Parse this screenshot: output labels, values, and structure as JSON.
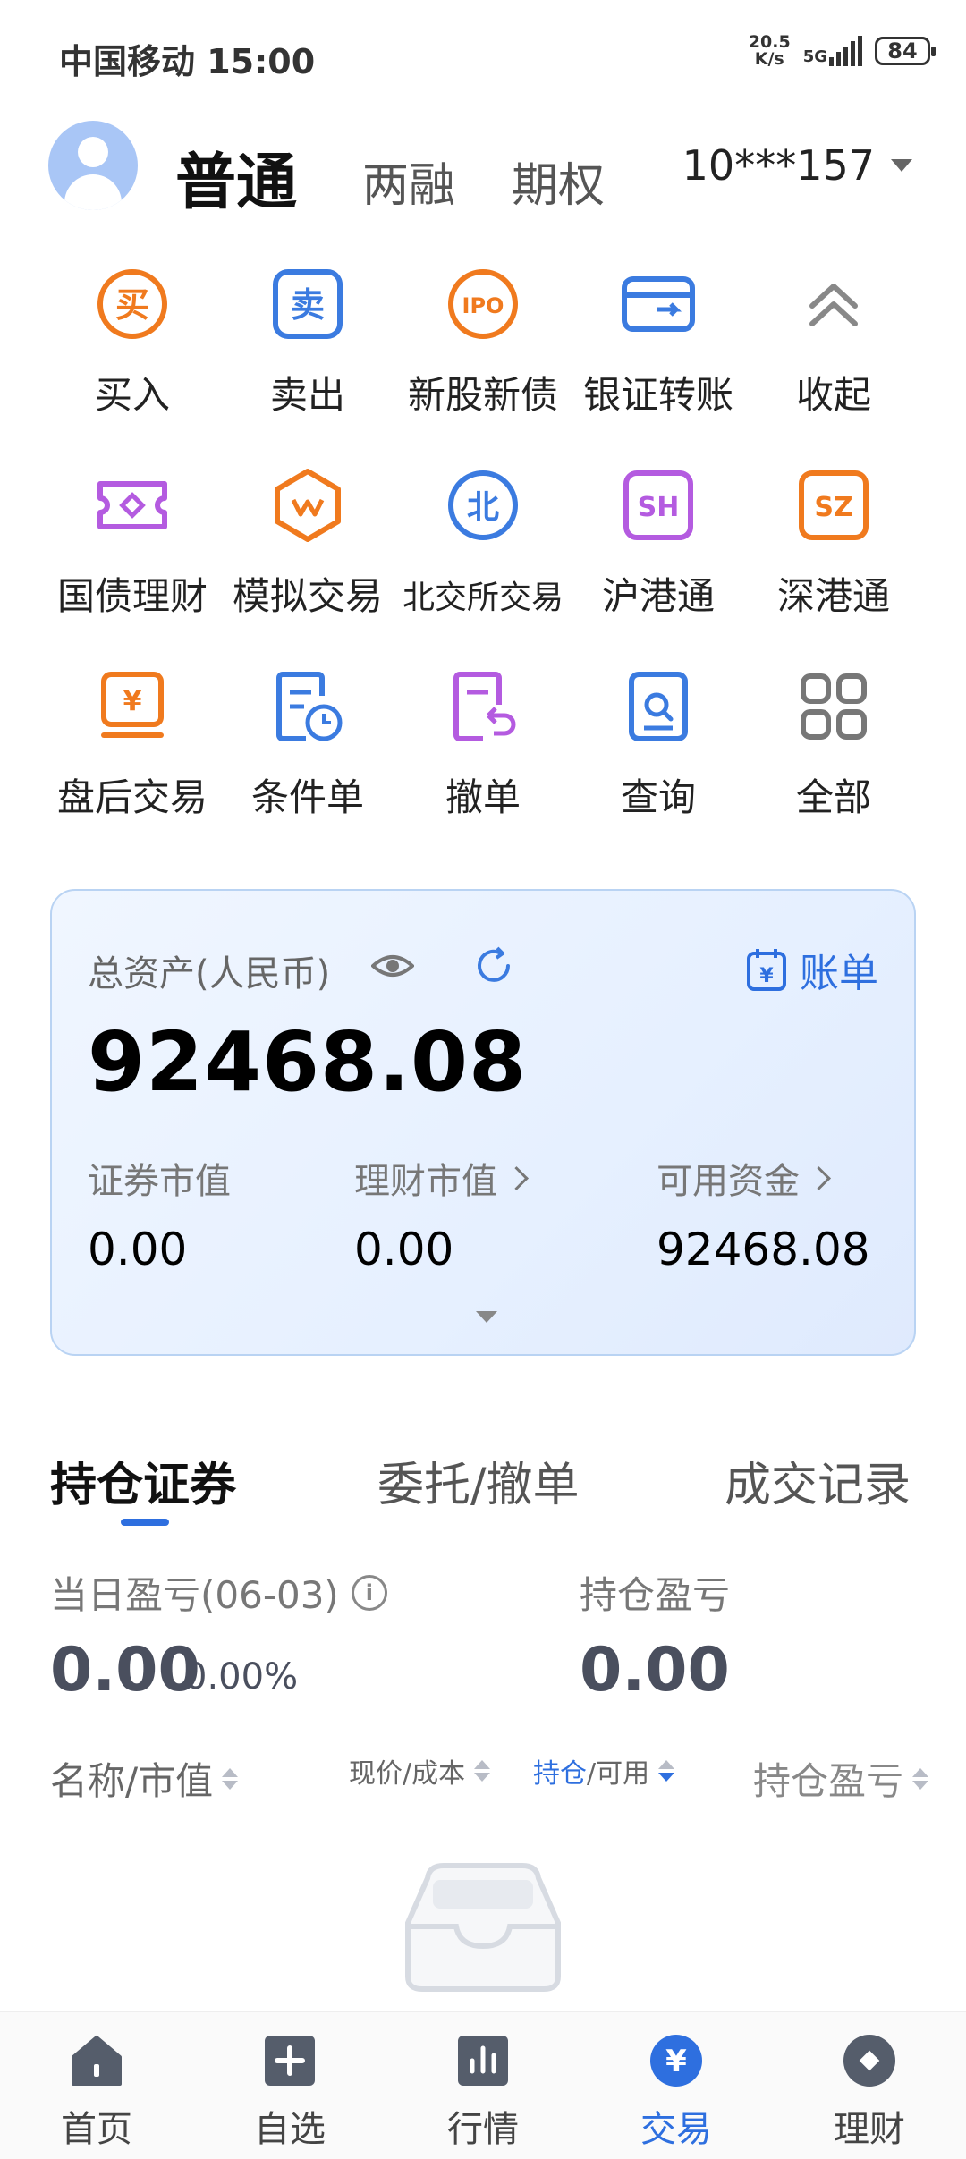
{
  "status_bar": {
    "carrier_time": "中国移动 15:00",
    "net_speed_value": "20.5",
    "net_speed_unit": "K/s",
    "network": "5G",
    "battery": "84"
  },
  "header": {
    "tabs": [
      {
        "label": "普通",
        "active": true
      },
      {
        "label": "两融",
        "active": false
      },
      {
        "label": "期权",
        "active": false
      }
    ],
    "account": "10***157"
  },
  "shortcuts": [
    {
      "label": "买入",
      "icon": "buy-icon",
      "color": "#f07a1e"
    },
    {
      "label": "卖出",
      "icon": "sell-icon",
      "color": "#3b7be0"
    },
    {
      "label": "新股新债",
      "icon": "ipo-icon",
      "color": "#f07a1e"
    },
    {
      "label": "银证转账",
      "icon": "bank-transfer-icon",
      "color": "#3b7be0"
    },
    {
      "label": "收起",
      "icon": "collapse-icon",
      "color": "#888888"
    },
    {
      "label": "国债理财",
      "icon": "bond-icon",
      "color": "#b45be0"
    },
    {
      "label": "模拟交易",
      "icon": "simulate-icon",
      "color": "#f07a1e"
    },
    {
      "label": "北交所交易",
      "icon": "bse-icon",
      "color": "#3b7be0"
    },
    {
      "label": "沪港通",
      "icon": "sh-connect-icon",
      "color": "#b45be0"
    },
    {
      "label": "深港通",
      "icon": "sz-connect-icon",
      "color": "#f07a1e"
    },
    {
      "label": "盘后交易",
      "icon": "after-hours-icon",
      "color": "#f07a1e"
    },
    {
      "label": "条件单",
      "icon": "conditional-order-icon",
      "color": "#3b7be0"
    },
    {
      "label": "撤单",
      "icon": "cancel-order-icon",
      "color": "#b45be0"
    },
    {
      "label": "查询",
      "icon": "query-icon",
      "color": "#3b7be0"
    },
    {
      "label": "全部",
      "icon": "all-icon",
      "color": "#777777"
    }
  ],
  "asset": {
    "title": "总资产(人民币)",
    "total": "92468.08",
    "bill_label": "账单",
    "columns": [
      {
        "label": "证券市值",
        "value": "0.00"
      },
      {
        "label": "理财市值",
        "value": "0.00"
      },
      {
        "label": "可用资金",
        "value": "92468.08"
      }
    ]
  },
  "position_tabs": [
    {
      "label": "持仓证券",
      "active": true
    },
    {
      "label": "委托/撤单",
      "active": false
    },
    {
      "label": "成交记录",
      "active": false
    }
  ],
  "pl": {
    "today_label": "当日盈亏(06-03)",
    "today_value": "0.00",
    "today_pct": "0.00%",
    "hold_label": "持仓盈亏",
    "hold_value": "0.00"
  },
  "table_headers": {
    "name": "名称/市值",
    "price": "现价/成本",
    "hold_a": "持仓",
    "hold_b": "/可用",
    "pl": "持仓盈亏"
  },
  "bottom_nav": [
    {
      "label": "首页",
      "icon": "home-icon",
      "active": false
    },
    {
      "label": "自选",
      "icon": "watchlist-icon",
      "active": false
    },
    {
      "label": "行情",
      "icon": "market-icon",
      "active": false
    },
    {
      "label": "交易",
      "icon": "trade-icon",
      "active": true
    },
    {
      "label": "理财",
      "icon": "wealth-icon",
      "active": false
    }
  ],
  "colors": {
    "accent": "#2e6fdf",
    "orange": "#f07a1e",
    "purple": "#b45be0"
  }
}
